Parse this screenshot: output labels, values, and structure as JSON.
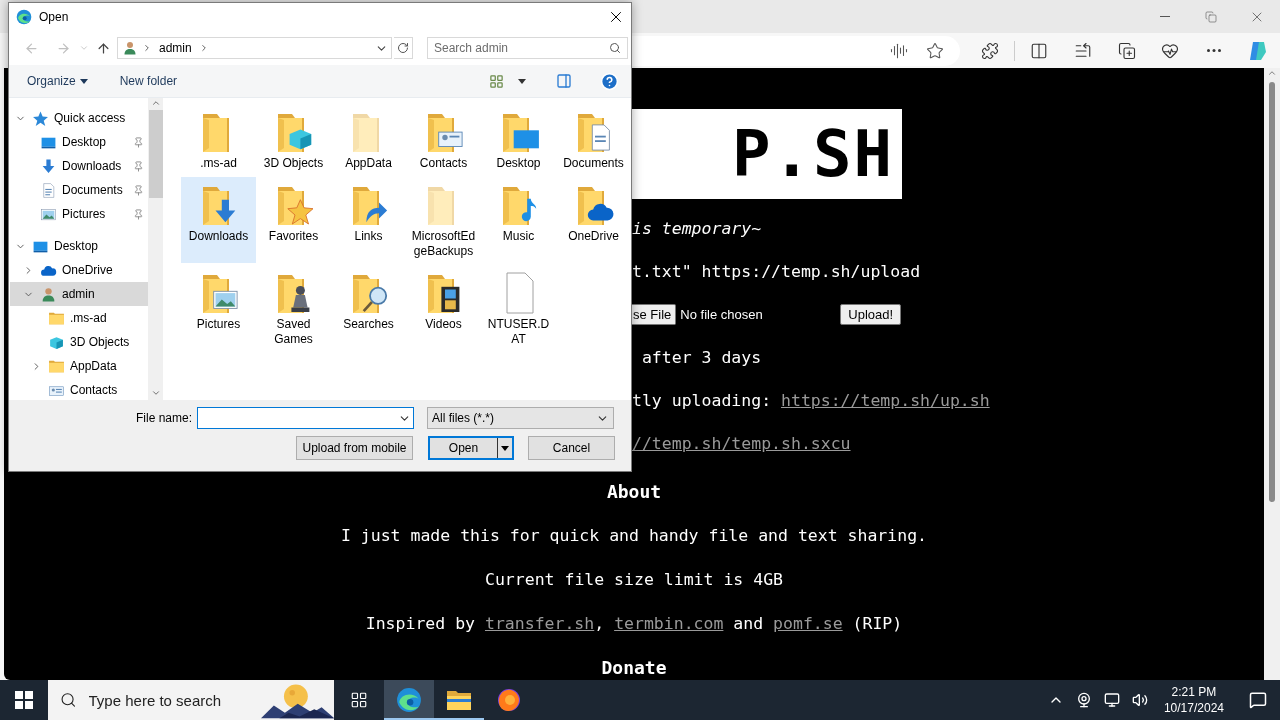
{
  "browser": {
    "page": {
      "logo": "P.SH",
      "tagline": "is temporary~",
      "command": "t.txt\" https://temp.sh/upload",
      "file_input": {
        "button": "se File",
        "status": "No file chosen"
      },
      "upload_button": "Upload!",
      "expiry": "after 3 days",
      "script_line": {
        "text": "tly uploading: ",
        "link": "https://temp.sh/up.sh"
      },
      "sharex_link": "//temp.sh/temp.sh.sxcu",
      "about_heading": "About",
      "paragraphs": [
        "I just made this for quick and handy file and text sharing.",
        "Current file size limit is 4GB"
      ],
      "inspired": [
        {
          "kind": "text",
          "text": "Inspired by "
        },
        {
          "kind": "link",
          "text": "transfer.sh"
        },
        {
          "kind": "text",
          "text": ", "
        },
        {
          "kind": "link",
          "text": "termbin.com"
        },
        {
          "kind": "text",
          "text": " and "
        },
        {
          "kind": "link",
          "text": "pomf.se"
        },
        {
          "kind": "text",
          "text": " (RIP)"
        }
      ],
      "donate_heading": "Donate"
    }
  },
  "dialog": {
    "title": "Open",
    "address": {
      "crumbs": [
        "admin"
      ]
    },
    "search": {
      "placeholder": "Search admin"
    },
    "toolbar": {
      "organize": "Organize",
      "new_folder": "New folder"
    },
    "tree": [
      {
        "label": "Quick access",
        "kind": "quick",
        "expanded": true,
        "selected": false,
        "children": [
          {
            "label": "Desktop",
            "kind": "desktop",
            "pinned": true,
            "selected": false
          },
          {
            "label": "Downloads",
            "kind": "downloads",
            "pinned": true,
            "selected": false
          },
          {
            "label": "Documents",
            "kind": "documents",
            "pinned": true,
            "selected": false
          },
          {
            "label": "Pictures",
            "kind": "pictures",
            "pinned": true,
            "selected": false
          }
        ]
      },
      {
        "label": "Desktop",
        "kind": "desktop",
        "expanded": true,
        "selected": false,
        "children": [
          {
            "label": "OneDrive",
            "kind": "onedrive",
            "expanded": false,
            "selected": false
          },
          {
            "label": "admin",
            "kind": "user",
            "expanded": true,
            "selected": true,
            "children": [
              {
                "label": ".ms-ad",
                "kind": "folder",
                "selected": false
              },
              {
                "label": "3D Objects",
                "kind": "objects",
                "selected": false
              },
              {
                "label": "AppData",
                "kind": "folder",
                "expanded": false,
                "selected": false
              },
              {
                "label": "Contacts",
                "kind": "contacts",
                "selected": false
              }
            ]
          }
        ]
      }
    ],
    "items": [
      {
        "label": ".ms-ad",
        "kind": "folder",
        "hidden": false,
        "selected": false
      },
      {
        "label": "3D Objects",
        "kind": "objects",
        "hidden": false,
        "selected": false
      },
      {
        "label": "AppData",
        "kind": "folder",
        "hidden": true,
        "selected": false
      },
      {
        "label": "Contacts",
        "kind": "contacts",
        "hidden": false,
        "selected": false
      },
      {
        "label": "Desktop",
        "kind": "desktop",
        "hidden": false,
        "selected": false
      },
      {
        "label": "Documents",
        "kind": "documents",
        "hidden": false,
        "selected": false
      },
      {
        "label": "Downloads",
        "kind": "downloads",
        "hidden": false,
        "selected": true
      },
      {
        "label": "Favorites",
        "kind": "favorites",
        "hidden": false,
        "selected": false
      },
      {
        "label": "Links",
        "kind": "links",
        "hidden": false,
        "selected": false
      },
      {
        "label": "MicrosoftEdgeBackups",
        "kind": "folder",
        "hidden": true,
        "selected": false
      },
      {
        "label": "Music",
        "kind": "music",
        "hidden": false,
        "selected": false
      },
      {
        "label": "OneDrive",
        "kind": "onedrive",
        "hidden": false,
        "selected": false
      },
      {
        "label": "Pictures",
        "kind": "pictures",
        "hidden": false,
        "selected": false
      },
      {
        "label": "Saved Games",
        "kind": "games",
        "hidden": false,
        "selected": false
      },
      {
        "label": "Searches",
        "kind": "searches",
        "hidden": false,
        "selected": false
      },
      {
        "label": "Videos",
        "kind": "videos",
        "hidden": false,
        "selected": false
      },
      {
        "label": "NTUSER.DAT",
        "kind": "file",
        "hidden": false,
        "selected": false
      }
    ],
    "file_name_label": "File name:",
    "filter": "All files (*.*)",
    "buttons": {
      "upload": "Upload from mobile",
      "open": "Open",
      "cancel": "Cancel"
    }
  },
  "taskbar": {
    "search": {
      "placeholder": "Type here to search"
    },
    "apps": [
      {
        "kind": "edge",
        "selected": true,
        "running": true
      },
      {
        "kind": "explorer",
        "selected": false,
        "running": true
      },
      {
        "kind": "firefox",
        "selected": false,
        "running": false
      }
    ],
    "clock": {
      "time": "2:21 PM",
      "date": "10/17/2024"
    }
  }
}
